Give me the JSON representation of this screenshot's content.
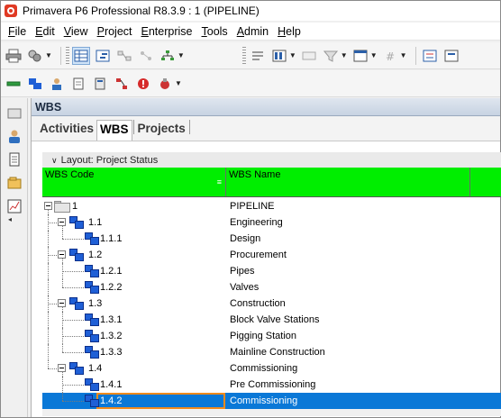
{
  "window": {
    "title": "Primavera P6 Professional R8.3.9 : 1 (PIPELINE)"
  },
  "menu": [
    {
      "accel": "F",
      "rest": "ile"
    },
    {
      "accel": "E",
      "rest": "dit"
    },
    {
      "accel": "V",
      "rest": "iew"
    },
    {
      "accel": "P",
      "rest": "roject"
    },
    {
      "accel": "E",
      "rest": "nterprise"
    },
    {
      "accel": "T",
      "rest": "ools"
    },
    {
      "accel": "A",
      "rest": "dmin"
    },
    {
      "accel": "H",
      "rest": "elp"
    }
  ],
  "panel": {
    "title": "WBS",
    "tabs": [
      "Activities",
      "WBS",
      "Projects"
    ],
    "active_tab": "WBS",
    "layout_label": "Layout: Project Status"
  },
  "grid": {
    "columns": [
      "WBS Code",
      "WBS Name",
      ""
    ],
    "rows": [
      {
        "code": "1",
        "name": "PIPELINE",
        "level": 0
      },
      {
        "code": "1.1",
        "name": "Engineering",
        "level": 1
      },
      {
        "code": "1.1.1",
        "name": "Design",
        "level": 2
      },
      {
        "code": "1.2",
        "name": "Procurement",
        "level": 1
      },
      {
        "code": "1.2.1",
        "name": "Pipes",
        "level": 2
      },
      {
        "code": "1.2.2",
        "name": "Valves",
        "level": 2
      },
      {
        "code": "1.3",
        "name": "Construction",
        "level": 1
      },
      {
        "code": "1.3.1",
        "name": "Block Valve Stations",
        "level": 2
      },
      {
        "code": "1.3.2",
        "name": "Pigging Station",
        "level": 2
      },
      {
        "code": "1.3.3",
        "name": "Mainline Construction",
        "level": 2
      },
      {
        "code": "1.4",
        "name": "Commissioning",
        "level": 1
      },
      {
        "code": "1.4.1",
        "name": "Pre Commissioning",
        "level": 2
      },
      {
        "code": "1.4.2",
        "name": "Commissioning",
        "level": 2,
        "selected": true
      }
    ]
  },
  "colors": {
    "header_green": "#00ee00",
    "selection_blue": "#0a78d7",
    "selection_border": "#f08a1c",
    "wbs_node_blue": "#1f5fd6"
  }
}
